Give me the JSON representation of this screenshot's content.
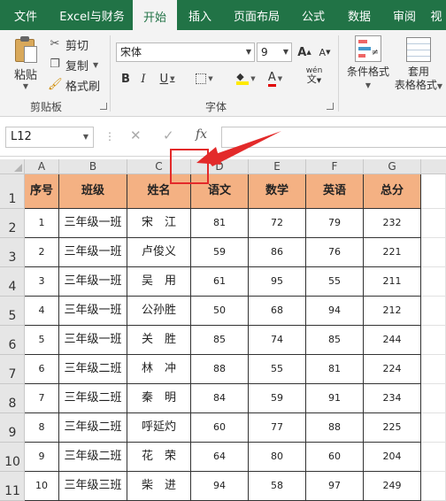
{
  "ribbon_tabs": [
    "文件",
    "Excel与财务",
    "开始",
    "插入",
    "页面布局",
    "公式",
    "数据",
    "审阅",
    "视"
  ],
  "active_tab": "开始",
  "clipboard": {
    "paste_label": "粘贴",
    "cut_label": "剪切",
    "copy_label": "复制",
    "format_painter_label": "格式刷",
    "group_label": "剪贴板"
  },
  "font": {
    "font_name": "宋体",
    "font_size": "9",
    "bold": "B",
    "italic": "I",
    "underline": "U",
    "grow": "A",
    "shrink": "A",
    "font_color_glyph": "A",
    "phonetic_glyph": "wén",
    "group_label": "字体"
  },
  "styles": {
    "conditional_format_label": "条件格式",
    "table_format_line1": "套用",
    "table_format_line2": "表格格式"
  },
  "formula_bar": {
    "name_box": "L12",
    "fx_label": "fx",
    "value": ""
  },
  "columns": [
    "A",
    "B",
    "C",
    "D",
    "E",
    "F",
    "G"
  ],
  "row_numbers": [
    "1",
    "2",
    "3",
    "4",
    "5",
    "6",
    "7",
    "8",
    "9",
    "10",
    "11"
  ],
  "table": {
    "headers": [
      "序号",
      "班级",
      "姓名",
      "语文",
      "数学",
      "英语",
      "总分"
    ],
    "rows": [
      [
        "1",
        "三年级一班",
        "宋　江",
        "81",
        "72",
        "79",
        "232"
      ],
      [
        "2",
        "三年级一班",
        "卢俊义",
        "59",
        "86",
        "76",
        "221"
      ],
      [
        "3",
        "三年级一班",
        "吴　用",
        "61",
        "95",
        "55",
        "211"
      ],
      [
        "4",
        "三年级一班",
        "公孙胜",
        "50",
        "68",
        "94",
        "212"
      ],
      [
        "5",
        "三年级一班",
        "关　胜",
        "85",
        "74",
        "85",
        "244"
      ],
      [
        "6",
        "三年级二班",
        "林　冲",
        "88",
        "55",
        "81",
        "224"
      ],
      [
        "7",
        "三年级二班",
        "秦　明",
        "84",
        "59",
        "91",
        "234"
      ],
      [
        "8",
        "三年级二班",
        "呼延灼",
        "60",
        "77",
        "88",
        "225"
      ],
      [
        "9",
        "三年级二班",
        "花　荣",
        "64",
        "80",
        "60",
        "204"
      ],
      [
        "10",
        "三年级三班",
        "柴　进",
        "94",
        "58",
        "97",
        "249"
      ]
    ]
  },
  "colors": {
    "ribbon_green": "#217346",
    "header_fill": "#f4b183",
    "annotation_red": "#e32a2a"
  }
}
